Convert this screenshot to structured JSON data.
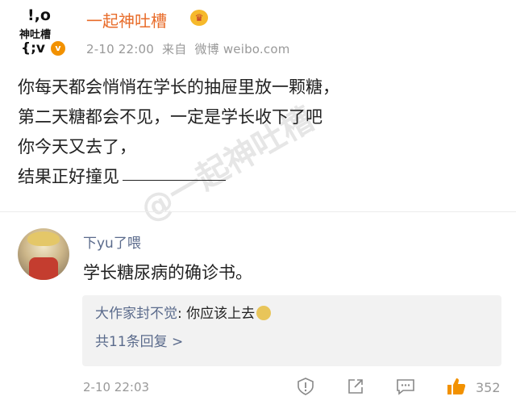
{
  "post": {
    "avatar_text": {
      "line1": "!,o",
      "line2": "神吐槽",
      "line3": "{;v"
    },
    "verify_badge": "v",
    "username": "一起神吐槽",
    "meta": {
      "time": "2-10 22:00",
      "from": "来自",
      "source": "微博 weibo.com"
    },
    "lines": [
      "你每天都会悄悄在学长的抽屉里放一颗糖，",
      "第二天糖都会不见，一定是学长收下了吧",
      "你今天又去了，",
      "结果正好撞见"
    ],
    "watermark": "@一起神吐槽"
  },
  "comment": {
    "name": "下yu了喂",
    "text": "学长糖尿病的确诊书。",
    "reply": {
      "author": "大作家封不觉",
      "separator": ": ",
      "text": "你应该上去"
    },
    "reply_more": "共11条回复 >",
    "time": "2-10 22:03",
    "likes": "352"
  },
  "icons": [
    "report-icon",
    "share-icon",
    "comment-icon",
    "like-icon"
  ],
  "colors": {
    "username": "#e86c2a",
    "link": "#5b6b8c",
    "meta": "#999999",
    "like": "#f29100"
  }
}
